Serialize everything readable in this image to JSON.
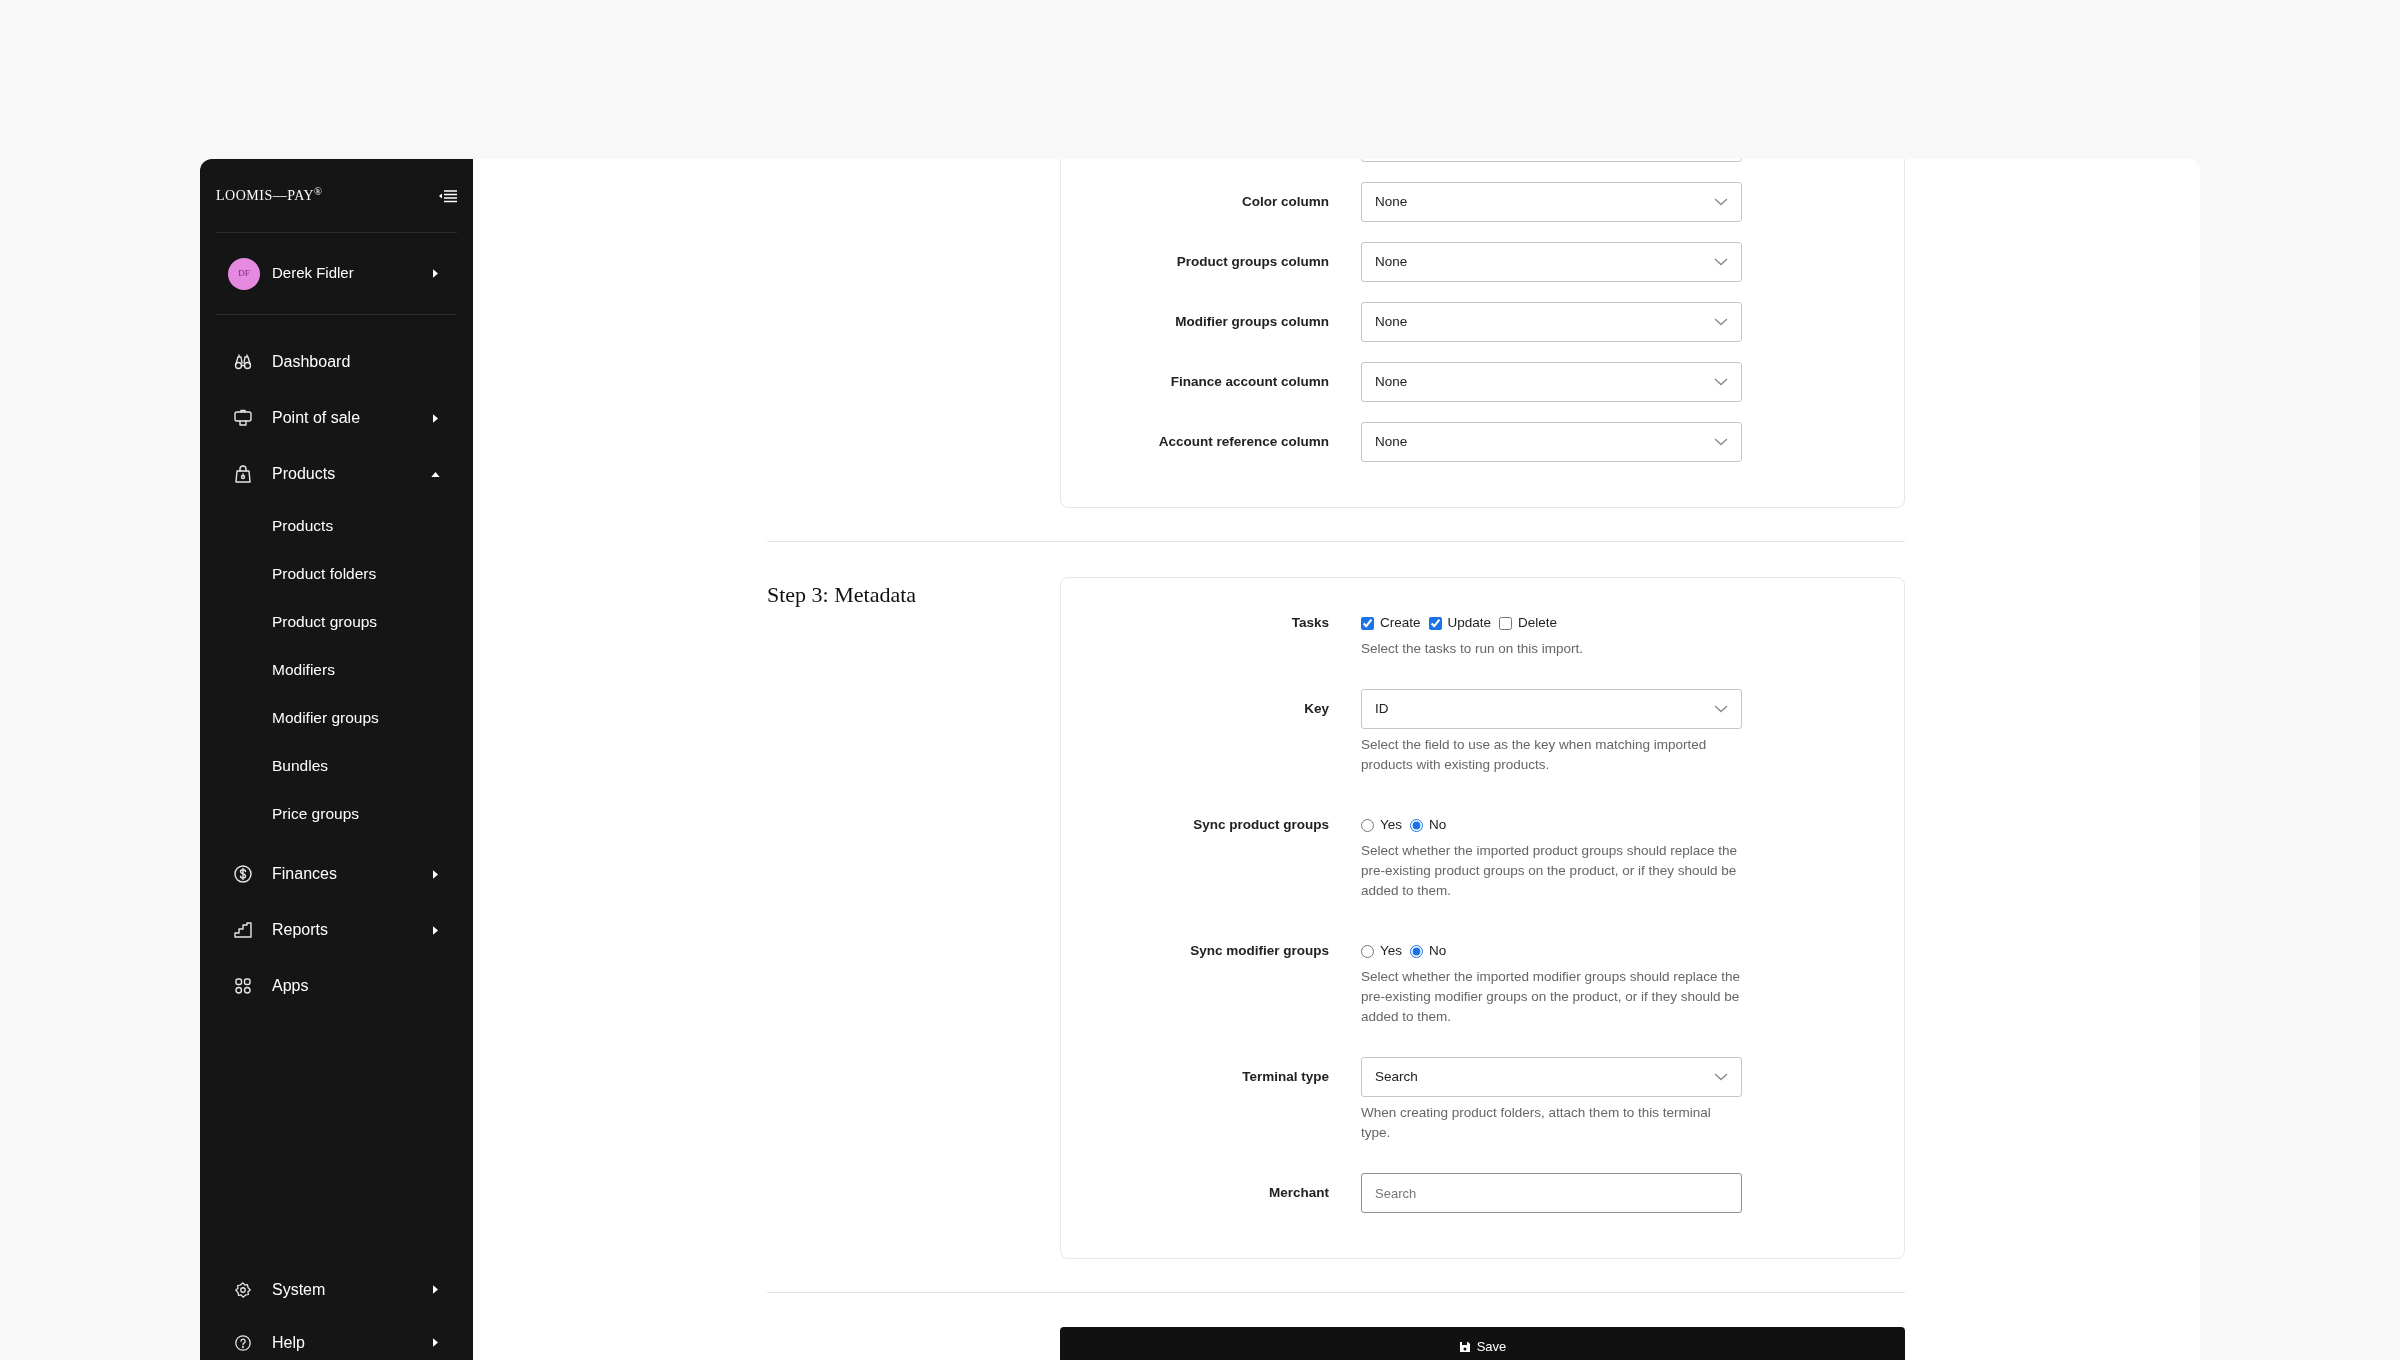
{
  "sidebar": {
    "logo": "LOOMIS—PAY$^{®}$",
    "user": {
      "initials": "DF",
      "name": "Derek Fidler",
      "expanded": false
    },
    "nav": [
      {
        "label": "Dashboard",
        "kind": "link"
      },
      {
        "label": "Point of sale",
        "kind": "group",
        "expanded": false
      },
      {
        "label": "Products",
        "kind": "group",
        "expanded": true,
        "children": [
          {
            "label": "Products"
          },
          {
            "label": "Product folders"
          },
          {
            "label": "Product groups"
          },
          {
            "label": "Modifiers"
          },
          {
            "label": "Modifier groups"
          },
          {
            "label": "Bundles"
          },
          {
            "label": "Price groups"
          }
        ]
      },
      {
        "label": "Finances",
        "kind": "group",
        "expanded": false
      },
      {
        "label": "Reports",
        "kind": "group",
        "expanded": false
      },
      {
        "label": "Apps",
        "kind": "link"
      }
    ],
    "bottom_nav": [
      {
        "label": "System",
        "kind": "group",
        "expanded": false
      },
      {
        "label": "Help",
        "kind": "group",
        "expanded": false
      }
    ]
  },
  "columns_card": {
    "fields": [
      {
        "label": "Color column",
        "value": "None"
      },
      {
        "label": "Product groups column",
        "value": "None"
      },
      {
        "label": "Modifier groups column",
        "value": "None"
      },
      {
        "label": "Finance account column",
        "value": "None"
      },
      {
        "label": "Account reference column",
        "value": "None"
      }
    ]
  },
  "metadata": {
    "heading": "Step 3: Metadata",
    "fields": [
      {
        "kind": "checkboxes",
        "label": "Tasks",
        "options": [
          {
            "label": "Create",
            "checked": true
          },
          {
            "label": "Update",
            "checked": true
          },
          {
            "label": "Delete",
            "checked": false
          }
        ],
        "help": "Select the tasks to run on this import."
      },
      {
        "kind": "select",
        "label": "Key",
        "value": "ID",
        "help": "Select the field to use as the key when matching imported products with existing products."
      },
      {
        "kind": "radios",
        "label": "Sync product groups",
        "options": [
          {
            "label": "Yes",
            "selected": false
          },
          {
            "label": "No",
            "selected": true
          }
        ],
        "help": "Select whether the imported product groups should replace the pre-existing product groups on the product, or if they should be added to them."
      },
      {
        "kind": "radios",
        "label": "Sync modifier groups",
        "options": [
          {
            "label": "Yes",
            "selected": false
          },
          {
            "label": "No",
            "selected": true
          }
        ],
        "help": "Select whether the imported modifier groups should replace the pre-existing modifier groups on the product, or if they should be added to them."
      },
      {
        "kind": "select",
        "label": "Terminal type",
        "value": "Search",
        "help": "When creating product folders, attach them to this terminal type."
      },
      {
        "kind": "input",
        "label": "Merchant",
        "placeholder": "Search"
      }
    ]
  },
  "save_button": {
    "label": "Save"
  }
}
